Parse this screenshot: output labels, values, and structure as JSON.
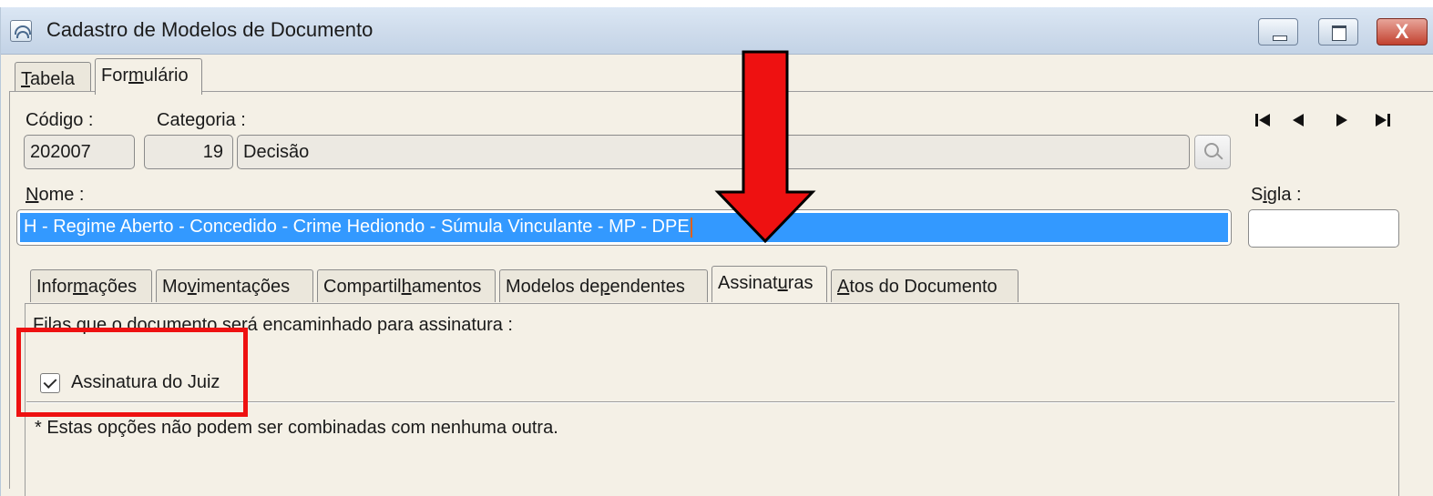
{
  "window": {
    "title": "Cadastro de Modelos de Documento",
    "icon": "app-icon",
    "close_label": "X"
  },
  "top_tabs": [
    {
      "label": "Tabela",
      "hotkey": "T",
      "rest": "abela",
      "active": false
    },
    {
      "label": "Formulário",
      "pre": "For",
      "hotkey": "m",
      "rest": "ulário",
      "active": true
    }
  ],
  "form": {
    "codigo_label": "Código :",
    "codigo_value": "202007",
    "categoria_label": "Categoria :",
    "categoria_id": "19",
    "categoria_name": "Decisão",
    "nome_label_hotkey": "N",
    "nome_label_rest": "ome :",
    "nome_value": "H - Regime Aberto - Concedido - Crime Hediondo - Súmula Vinculante - MP - DPE",
    "sigla_label_pre": "S",
    "sigla_label_hotkey": "i",
    "sigla_label_rest": "gla :",
    "sigla_value": ""
  },
  "nav": {
    "first": "⏮",
    "prev": "◀",
    "next": "▶",
    "last": "⏭"
  },
  "sub_tabs": [
    {
      "pre": "Infor",
      "hotkey": "m",
      "rest": "ações",
      "active": false
    },
    {
      "pre": "Mo",
      "hotkey": "v",
      "rest": "imentações",
      "active": false
    },
    {
      "pre": "Compartil",
      "hotkey": "h",
      "rest": "amentos",
      "active": false
    },
    {
      "pre": "Modelos de",
      "hotkey": "p",
      "rest": "endentes",
      "active": false
    },
    {
      "pre": "Assinat",
      "hotkey": "u",
      "rest": "ras",
      "active": true
    },
    {
      "pre": "",
      "hotkey": "A",
      "rest": "tos do Documento",
      "active": false
    }
  ],
  "assinaturas": {
    "intro": "Filas que o documento será encaminhado para assinatura :",
    "checkbox_label": "Assinatura do Juiz",
    "checkbox_checked": true,
    "note": "* Estas opções não podem ser combinadas com nenhuma outra."
  },
  "annotation": {
    "arrow_color": "#ee1111",
    "box_color": "#ee1111"
  }
}
